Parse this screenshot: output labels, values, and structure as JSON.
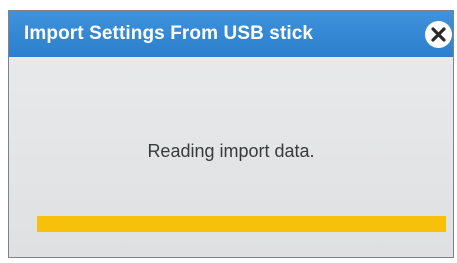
{
  "dialog": {
    "title": "Import Settings From USB stick",
    "close_icon": "close-icon",
    "message": "Reading import data.",
    "progress": 1.0
  },
  "colors": {
    "titlebar": "#2f86d3",
    "progress": "#f7c00a",
    "body": "#e4e5e7"
  }
}
